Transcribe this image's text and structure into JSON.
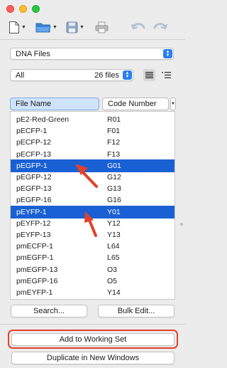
{
  "toolbar": {
    "icons": [
      "new-document-icon",
      "open-folder-icon",
      "save-icon",
      "print-icon",
      "undo-icon",
      "redo-icon"
    ]
  },
  "source_popup": {
    "value": "DNA Files"
  },
  "filter": {
    "value": "All",
    "count": "26 files"
  },
  "columns": {
    "col1": "File Name",
    "col2": "Code Number"
  },
  "rows": [
    {
      "name": "pE2-Red-Green",
      "code": "R01",
      "selected": false
    },
    {
      "name": "pECFP-1",
      "code": "F01",
      "selected": false
    },
    {
      "name": "pECFP-12",
      "code": "F12",
      "selected": false
    },
    {
      "name": "pECFP-13",
      "code": "F13",
      "selected": false
    },
    {
      "name": "pEGFP-1",
      "code": "G01",
      "selected": true
    },
    {
      "name": "pEGFP-12",
      "code": "G12",
      "selected": false
    },
    {
      "name": "pEGFP-13",
      "code": "G13",
      "selected": false
    },
    {
      "name": "pEGFP-16",
      "code": "G16",
      "selected": false
    },
    {
      "name": "pEYFP-1",
      "code": "Y01",
      "selected": true
    },
    {
      "name": "pEYFP-12",
      "code": "Y12",
      "selected": false
    },
    {
      "name": "pEYFP-13",
      "code": "Y13",
      "selected": false
    },
    {
      "name": "pmECFP-1",
      "code": "L64",
      "selected": false
    },
    {
      "name": "pmEGFP-1",
      "code": "L65",
      "selected": false
    },
    {
      "name": "pmEGFP-13",
      "code": "O3",
      "selected": false
    },
    {
      "name": "pmEGFP-16",
      "code": "O5",
      "selected": false
    },
    {
      "name": "pmEYFP-1",
      "code": "Y14",
      "selected": false
    }
  ],
  "buttons": {
    "search": "Search...",
    "bulk_edit": "Bulk Edit...",
    "add_to_working_set": "Add to Working Set",
    "duplicate": "Duplicate in New Windows"
  },
  "colors": {
    "selection": "#1960d4",
    "annotation": "#e2412b"
  }
}
